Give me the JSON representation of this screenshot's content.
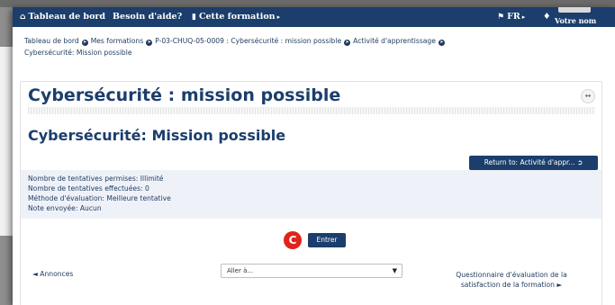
{
  "navbar": {
    "dashboard_label": "Tableau de bord",
    "help_label": "Besoin d'aide?",
    "course_label": "Cette formation",
    "course_caret": "▸",
    "lang_label": "FR",
    "lang_caret": "▸",
    "user_label": "Votre nom",
    "icons": {
      "dashboard": "home-icon",
      "course": "book-icon",
      "lang": "flag-icon",
      "notifications": "bell-icon"
    }
  },
  "breadcrumb": {
    "items": [
      "Tableau de bord",
      "Mes formations",
      "P-03-CHUQ-05-0009 : Cybersécurité : mission possible",
      "Activité d'apprentissage",
      "Cybersécurité: Mission possible"
    ],
    "separator_icon": "circle-arrow-right-icon"
  },
  "page": {
    "course_title": "Cybersécurité : mission possible",
    "activity_title": "Cybersécurité: Mission possible",
    "return_button": "Return to: Activité d'appr...",
    "info_lines": [
      "Nombre de tentatives permises: Illimité",
      "Nombre de tentatives effectuées: 0",
      "Méthode d'évaluation: Meilleure tentative",
      "Note envoyée: Aucun"
    ],
    "badge_letter": "C",
    "enter_button": "Entrer",
    "prev_link": "◄ Annonces",
    "jump_select": {
      "value": "Aller à...",
      "arrow": "▼"
    },
    "next_link": "Questionnaire d'évaluation de la satisfaction de la formation ►"
  },
  "colors": {
    "primary": "#1b3e6c",
    "badge": "#e2231a",
    "info_bg": "#eef2f8"
  }
}
